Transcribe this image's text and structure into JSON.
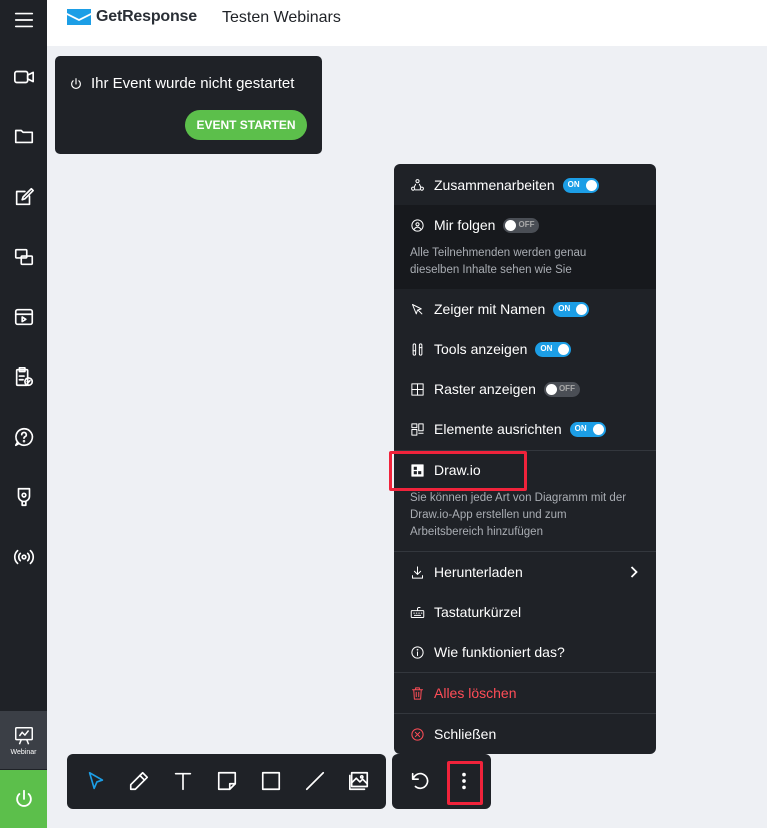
{
  "sidebar": {
    "items": [
      {
        "icon": "menu-icon"
      },
      {
        "icon": "video-camera-icon"
      },
      {
        "icon": "folder-icon"
      },
      {
        "icon": "edit-icon"
      },
      {
        "icon": "screens-icon"
      },
      {
        "icon": "media-icon"
      },
      {
        "icon": "clipboard-icon"
      },
      {
        "icon": "help-icon"
      },
      {
        "icon": "badge-icon"
      },
      {
        "icon": "broadcast-icon"
      }
    ],
    "webinar_label": "Webinar",
    "power_icon": "power-icon"
  },
  "header": {
    "logo_text": "GetResponse",
    "title": "Testen Webinars"
  },
  "event": {
    "status_text": "Ihr Event wurde nicht gestartet",
    "start_label": "EVENT STARTEN"
  },
  "menu": {
    "collaborate": {
      "label": "Zusammenarbeiten",
      "toggle": "ON"
    },
    "follow": {
      "label": "Mir folgen",
      "toggle": "OFF",
      "desc_line1": "Alle Teilnehmenden werden genau",
      "desc_line2": "dieselben Inhalte sehen wie Sie"
    },
    "pointer": {
      "label": "Zeiger mit Namen",
      "toggle": "ON"
    },
    "tools": {
      "label": "Tools anzeigen",
      "toggle": "ON"
    },
    "grid": {
      "label": "Raster anzeigen",
      "toggle": "OFF"
    },
    "align": {
      "label": "Elemente ausrichten",
      "toggle": "ON"
    },
    "drawio": {
      "label": "Draw.io",
      "desc_line1": "Sie können jede Art von Diagramm mit der",
      "desc_line2": "Draw.io-App erstellen und zum",
      "desc_line3": "Arbeitsbereich hinzufügen"
    },
    "download": {
      "label": "Herunterladen"
    },
    "shortcuts": {
      "label": "Tastaturkürzel"
    },
    "howto": {
      "label": "Wie funktioniert das?"
    },
    "clear": {
      "label": "Alles löschen"
    },
    "close": {
      "label": "Schließen"
    }
  },
  "toolbar": {
    "tools": [
      "select-icon",
      "pencil-icon",
      "text-icon",
      "sticky-note-icon",
      "rectangle-icon",
      "line-icon",
      "image-icon"
    ],
    "extra": [
      "undo-icon",
      "more-vertical-icon"
    ]
  },
  "colors": {
    "dark": "#1f2227",
    "accent_blue": "#1c9ee6",
    "green": "#5cbf4b",
    "highlight_red": "#f0233b"
  }
}
